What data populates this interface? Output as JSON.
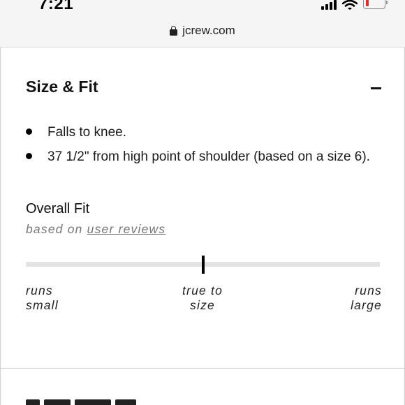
{
  "status_bar": {
    "time": "7:21",
    "battery_color": "#e52a2a"
  },
  "url_bar": {
    "domain": "jcrew.com",
    "icon": "lock-icon"
  },
  "size_fit": {
    "title": "Size & Fit",
    "toggle_icon": "minus-icon",
    "bullets": [
      "Falls to knee.",
      "37 1/2\" from high point of shoulder (based on a size 6)."
    ]
  },
  "overall_fit": {
    "title": "Overall Fit",
    "subtitle_prefix": "based on",
    "subtitle_link": "user reviews",
    "rating": 0.5,
    "labels": {
      "left": [
        "runs",
        "small"
      ],
      "center": [
        "true to",
        "size"
      ],
      "right": [
        "runs",
        "large"
      ]
    }
  }
}
